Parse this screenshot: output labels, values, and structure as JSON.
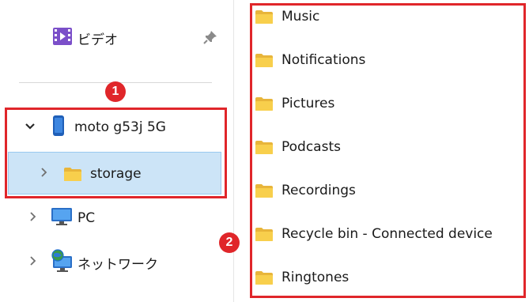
{
  "nav": {
    "videos_label": "ビデオ",
    "device_label": "moto g53j 5G",
    "storage_label": "storage",
    "pc_label": "PC",
    "network_label": "ネットワーク"
  },
  "annotations": {
    "badge1": "1",
    "badge2": "2",
    "highlight_color": "#e0262a"
  },
  "folders": [
    "Music",
    "Notifications",
    "Pictures",
    "Podcasts",
    "Recordings",
    "Recycle bin - Connected device",
    "Ringtones"
  ],
  "colors": {
    "folder": "#f8cf4c",
    "selection_bg": "#cce4f7"
  }
}
